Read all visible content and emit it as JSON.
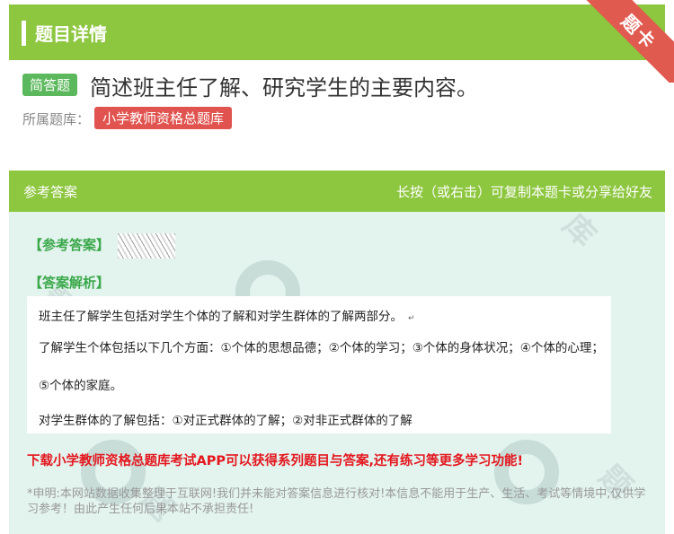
{
  "header": {
    "title": "题目详情",
    "ribbon_label": "题卡"
  },
  "question": {
    "type_tag": "简答题",
    "text": "简述班主任了解、研究学生的主要内容。",
    "bank_label": "所属题库：",
    "bank_name": "小学教师资格总题库"
  },
  "answer_panel": {
    "title": "参考答案",
    "hint": "长按（或右击）可复制本题卡或分享给好友",
    "answer_label": "【参考答案】",
    "explanation_label": "【答案解析】",
    "explanation_lines": [
      "班主任了解学生包括对学生个体的了解和对学生群体的了解两部分。",
      "了解学生个体包括以下几个方面：①个体的思想品德；②个体的学习；③个体的身体状况；④个体的心理；",
      "⑤个体的家庭。",
      "对学生群体的了解包括：①对正式群体的了解；②对非正式群体的了解"
    ],
    "promo": "下载小学教师资格总题库考试APP可以获得系列题目与答案,还有练习等更多学习功能!",
    "disclaimer": "*申明:本网站数据收集整理于互联网!我们并未能对答案信息进行核对!本信息不能用于生产、生活、考试等情境中,仅供学习参考！由此产生任何后果本站不承担责任!"
  },
  "colors": {
    "header_green": "#8dc63f",
    "tag_green": "#5cb85c",
    "bank_red": "#e0534f",
    "label_green": "#3aa84a",
    "promo_red": "#e4171e",
    "panel_bg": "#e3f3ee"
  }
}
